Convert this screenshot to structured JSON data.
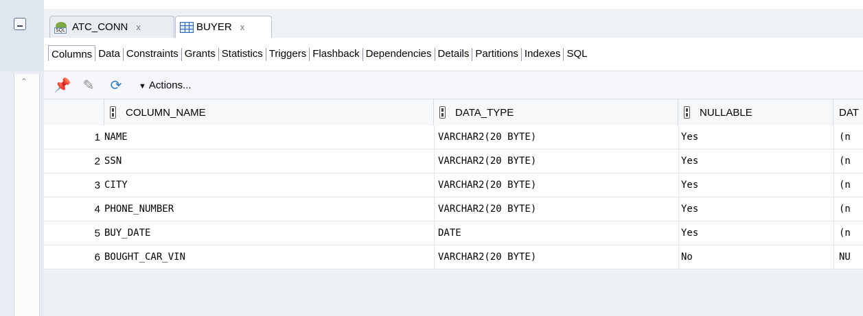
{
  "window": {
    "tabs": [
      {
        "label": "ATC_CONN",
        "icon": "database-connection-icon",
        "active": false
      },
      {
        "label": "BUYER",
        "icon": "table-icon",
        "active": true
      }
    ],
    "close_glyph": "x"
  },
  "subtabs": [
    "Columns",
    "Data",
    "Constraints",
    "Grants",
    "Statistics",
    "Triggers",
    "Flashback",
    "Dependencies",
    "Details",
    "Partitions",
    "Indexes",
    "SQL"
  ],
  "toolbar": {
    "actions_label": "Actions...",
    "icons": [
      "pin-icon",
      "edit-icon",
      "refresh-icon"
    ]
  },
  "grid": {
    "columns": [
      "COLUMN_NAME",
      "DATA_TYPE",
      "NULLABLE",
      "DAT"
    ],
    "rows": [
      {
        "num": "1",
        "name": "NAME",
        "type": "VARCHAR2(20 BYTE)",
        "nullable": "Yes",
        "default": "(n"
      },
      {
        "num": "2",
        "name": "SSN",
        "type": "VARCHAR2(20 BYTE)",
        "nullable": "Yes",
        "default": "(n"
      },
      {
        "num": "3",
        "name": "CITY",
        "type": "VARCHAR2(20 BYTE)",
        "nullable": "Yes",
        "default": "(n"
      },
      {
        "num": "4",
        "name": "PHONE_NUMBER",
        "type": "VARCHAR2(20 BYTE)",
        "nullable": "Yes",
        "default": "(n"
      },
      {
        "num": "5",
        "name": "BUY_DATE",
        "type": "DATE",
        "nullable": "Yes",
        "default": "(n"
      },
      {
        "num": "6",
        "name": "BOUGHT_CAR_VIN",
        "type": "VARCHAR2(20 BYTE)",
        "nullable": "No",
        "default": "NU"
      }
    ]
  }
}
